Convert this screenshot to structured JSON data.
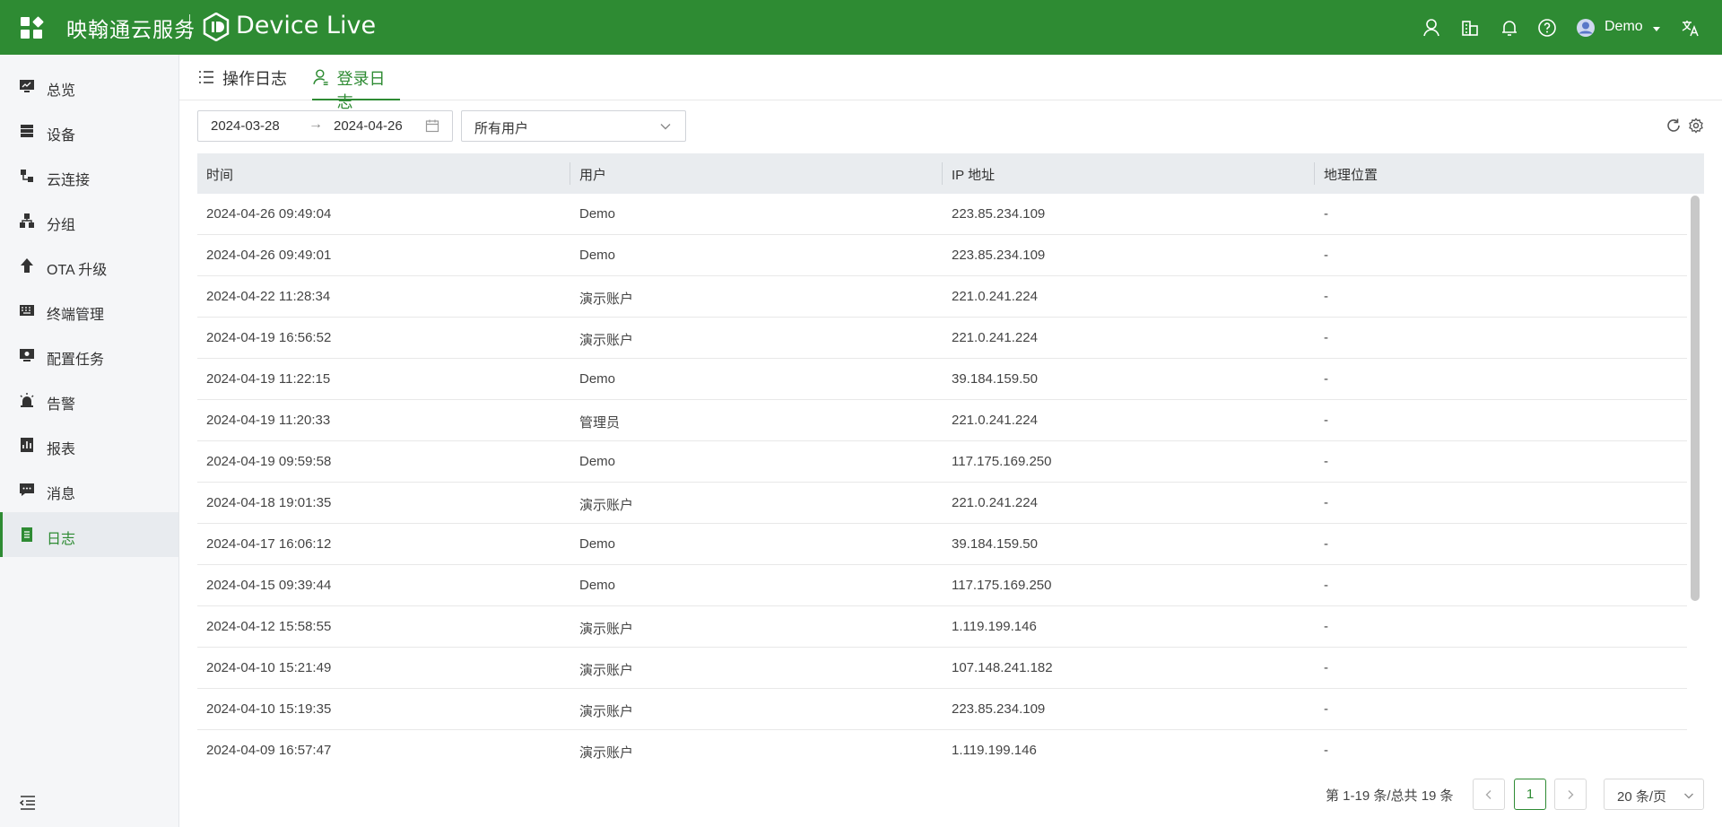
{
  "header": {
    "brand": "映翰通云服务",
    "product": "Device Live",
    "user": "Demo"
  },
  "sidebar": {
    "items": [
      {
        "label": "总览",
        "icon": "monitor-icon"
      },
      {
        "label": "设备",
        "icon": "server-icon"
      },
      {
        "label": "云连接",
        "icon": "link-icon"
      },
      {
        "label": "分组",
        "icon": "group-icon"
      },
      {
        "label": "OTA 升级",
        "icon": "upload-icon"
      },
      {
        "label": "终端管理",
        "icon": "keyboard-icon"
      },
      {
        "label": "配置任务",
        "icon": "task-icon"
      },
      {
        "label": "告警",
        "icon": "alarm-icon"
      },
      {
        "label": "报表",
        "icon": "report-icon"
      },
      {
        "label": "消息",
        "icon": "message-icon"
      },
      {
        "label": "日志",
        "icon": "log-icon"
      }
    ],
    "active": "日志"
  },
  "tabs": [
    {
      "label": "操作日志"
    },
    {
      "label": "登录日志"
    }
  ],
  "filters": {
    "start_date": "2024-03-28",
    "end_date": "2024-04-26",
    "user_select": "所有用户"
  },
  "table": {
    "columns": [
      "时间",
      "用户",
      "IP 地址",
      "地理位置"
    ],
    "rows": [
      [
        "2024-04-26 09:49:04",
        "Demo",
        "223.85.234.109",
        "-"
      ],
      [
        "2024-04-26 09:49:01",
        "Demo",
        "223.85.234.109",
        "-"
      ],
      [
        "2024-04-22 11:28:34",
        "演示账户",
        "221.0.241.224",
        "-"
      ],
      [
        "2024-04-19 16:56:52",
        "演示账户",
        "221.0.241.224",
        "-"
      ],
      [
        "2024-04-19 11:22:15",
        "Demo",
        "39.184.159.50",
        "-"
      ],
      [
        "2024-04-19 11:20:33",
        "管理员",
        "221.0.241.224",
        "-"
      ],
      [
        "2024-04-19 09:59:58",
        "Demo",
        "117.175.169.250",
        "-"
      ],
      [
        "2024-04-18 19:01:35",
        "演示账户",
        "221.0.241.224",
        "-"
      ],
      [
        "2024-04-17 16:06:12",
        "Demo",
        "39.184.159.50",
        "-"
      ],
      [
        "2024-04-15 09:39:44",
        "Demo",
        "117.175.169.250",
        "-"
      ],
      [
        "2024-04-12 15:58:55",
        "演示账户",
        "1.119.199.146",
        "-"
      ],
      [
        "2024-04-10 15:21:49",
        "演示账户",
        "107.148.241.182",
        "-"
      ],
      [
        "2024-04-10 15:19:35",
        "演示账户",
        "223.85.234.109",
        "-"
      ],
      [
        "2024-04-09 16:57:47",
        "演示账户",
        "1.119.199.146",
        "-"
      ]
    ]
  },
  "pagination": {
    "summary": "第 1-19 条/总共 19 条",
    "current_page": "1",
    "page_size": "20 条/页"
  },
  "colors": {
    "primary": "#2e8b33",
    "sidebar_bg": "#f5f6f8",
    "table_header_bg": "#e9ecef"
  }
}
